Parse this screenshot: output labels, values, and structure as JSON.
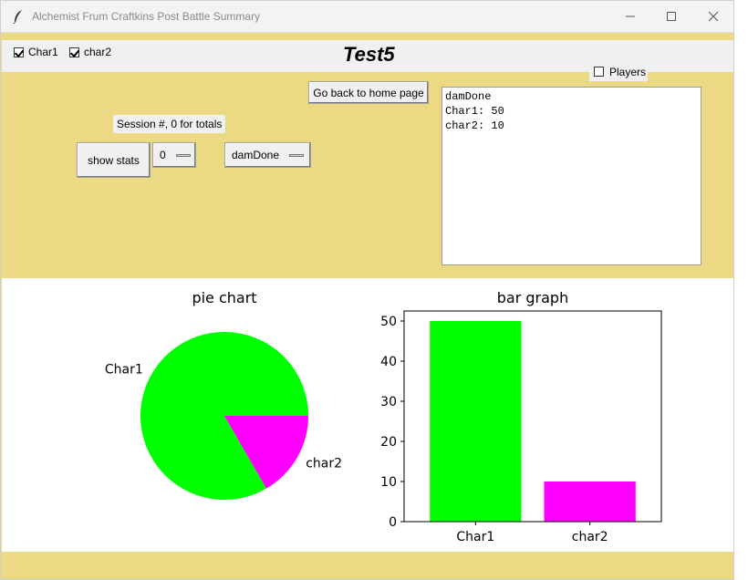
{
  "window": {
    "title": "Alchemist Frum Craftkins Post Battle Summary",
    "icon": "feather-icon",
    "controls": [
      "minimize-icon",
      "maximize-icon",
      "close-icon"
    ]
  },
  "header": {
    "checkboxes": [
      {
        "label": "Char1",
        "checked": true
      },
      {
        "label": "char2",
        "checked": true
      }
    ],
    "page_title": "Test5",
    "players_checkbox": {
      "label": "Players",
      "checked": false
    }
  },
  "controls": {
    "home_button": "Go back to home page",
    "session_label": "Session #, 0 for totals",
    "show_stats_button": "show stats",
    "session_value": "0",
    "stat_value": "damDone"
  },
  "textbox": {
    "lines": [
      "damDone",
      "Char1: 50",
      "char2: 10"
    ]
  },
  "colors": {
    "background": "#ecd983",
    "char1": "#00ff00",
    "char2": "#ff00ff"
  },
  "chart_data": [
    {
      "type": "pie",
      "title": "pie chart",
      "labels": [
        "Char1",
        "char2"
      ],
      "values": [
        50,
        10
      ],
      "colors": [
        "#00ff00",
        "#ff00ff"
      ]
    },
    {
      "type": "bar",
      "title": "bar graph",
      "categories": [
        "Char1",
        "char2"
      ],
      "values": [
        50,
        10
      ],
      "colors": [
        "#00ff00",
        "#ff00ff"
      ],
      "ylim": [
        0,
        52.5
      ],
      "yticks": [
        "0",
        "10",
        "20",
        "30",
        "40",
        "50"
      ]
    }
  ]
}
